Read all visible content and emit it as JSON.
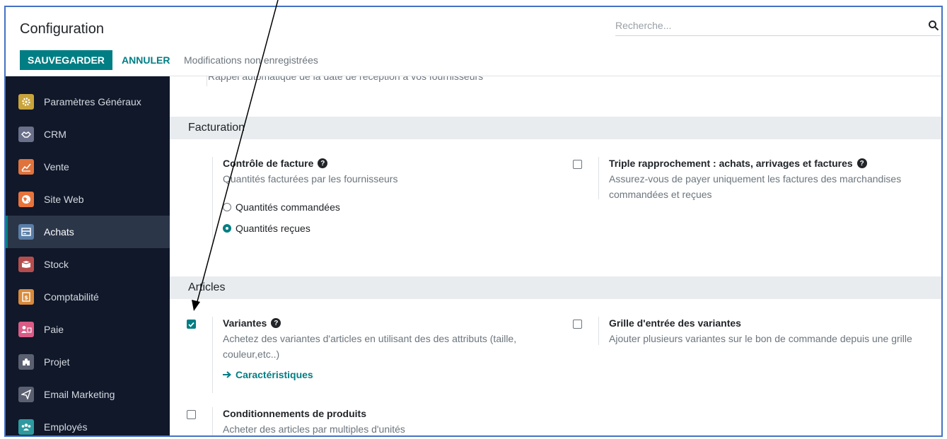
{
  "control_panel": {
    "title": "Configuration",
    "save_label": "SAUVEGARDER",
    "cancel_label": "ANNULER",
    "unsaved_text": "Modifications non enregistrées",
    "search_placeholder": "Recherche..."
  },
  "sidebar": {
    "items": [
      {
        "label": "Paramètres Généraux",
        "icon": "gear-icon",
        "color": "#c9a43b"
      },
      {
        "label": "CRM",
        "icon": "handshake-icon",
        "color": "#6a6f8a"
      },
      {
        "label": "Vente",
        "icon": "chart-icon",
        "color": "#e0733c"
      },
      {
        "label": "Site Web",
        "icon": "globe-icon",
        "color": "#e8743c"
      },
      {
        "label": "Achats",
        "icon": "card-icon",
        "color": "#5a7fa8",
        "active": true
      },
      {
        "label": "Stock",
        "icon": "box-icon",
        "color": "#b44e4e"
      },
      {
        "label": "Comptabilité",
        "icon": "document-icon",
        "color": "#d98a3a"
      },
      {
        "label": "Paie",
        "icon": "people-icon",
        "color": "#d95c86"
      },
      {
        "label": "Projet",
        "icon": "puzzle-icon",
        "color": "#6b6f7a"
      },
      {
        "label": "Email Marketing",
        "icon": "paper-plane-icon",
        "color": "#6b6f7a"
      },
      {
        "label": "Employés",
        "icon": "team-icon",
        "color": "#2e9aa0"
      }
    ]
  },
  "main": {
    "cut_text": "Rappel automatique de la date de réception à vos fournisseurs",
    "facturation": {
      "title": "Facturation",
      "invoice_control": {
        "title": "Contrôle de facture",
        "desc": "Quantités facturées par les fournisseurs",
        "options": [
          "Quantités commandées",
          "Quantités reçues"
        ],
        "selected": "Quantités reçues"
      },
      "three_way": {
        "title": "Triple rapprochement : achats, arrivages et factures",
        "desc_line1": "Assurez-vous de payer uniquement les factures des marchandises",
        "desc_line2": "commandées et reçues"
      }
    },
    "articles": {
      "title": "Articles",
      "variants": {
        "title": "Variantes",
        "desc_line1": "Achetez des variantes d'articles en utilisant des des attributs (taille,",
        "desc_line2": "couleur,etc..)",
        "link": "Caractéristiques",
        "checked": true
      },
      "variant_grid": {
        "title": "Grille d'entrée des variantes",
        "desc": "Ajouter plusieurs variantes sur le bon de commande depuis une grille"
      },
      "packaging": {
        "title": "Conditionnements de produits",
        "desc": "Acheter des articles par multiples d'unités"
      }
    }
  },
  "accent_color": "#017e84"
}
